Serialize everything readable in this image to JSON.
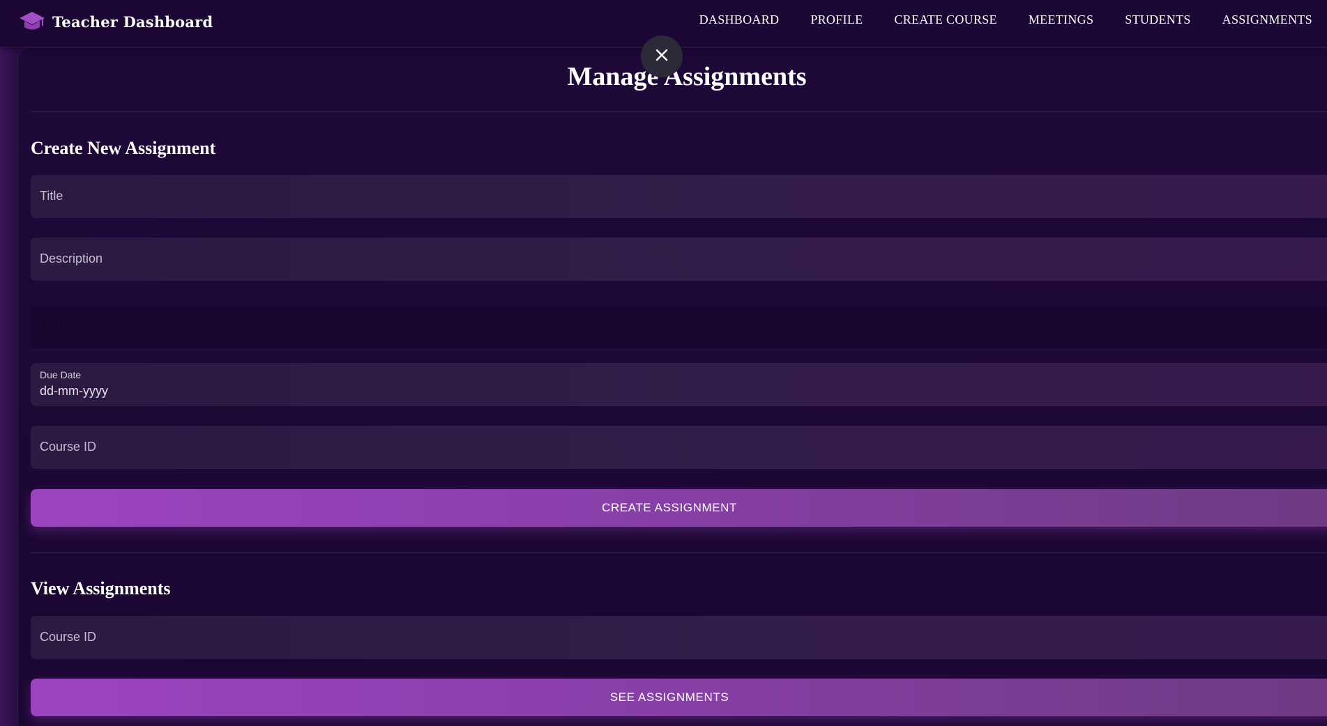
{
  "header": {
    "brand": "Teacher Dashboard",
    "nav": [
      "DASHBOARD",
      "PROFILE",
      "CREATE COURSE",
      "MEETINGS",
      "STUDENTS",
      "ASSIGNMENTS"
    ]
  },
  "page": {
    "title": "Manage Assignments"
  },
  "create": {
    "heading": "Create New Assignment",
    "title_placeholder": "Title",
    "description_placeholder": "Description",
    "type_value": "Text",
    "due_label": "Due Date",
    "due_value": "dd-mm-yyyy",
    "course_placeholder": "Course ID",
    "submit_label": "CREATE ASSIGNMENT"
  },
  "view": {
    "heading": "View Assignments",
    "course_placeholder": "Course ID",
    "submit_label": "SEE ASSIGNMENTS"
  },
  "colors": {
    "accent": "#9c44c0",
    "background": "#1c0733"
  }
}
